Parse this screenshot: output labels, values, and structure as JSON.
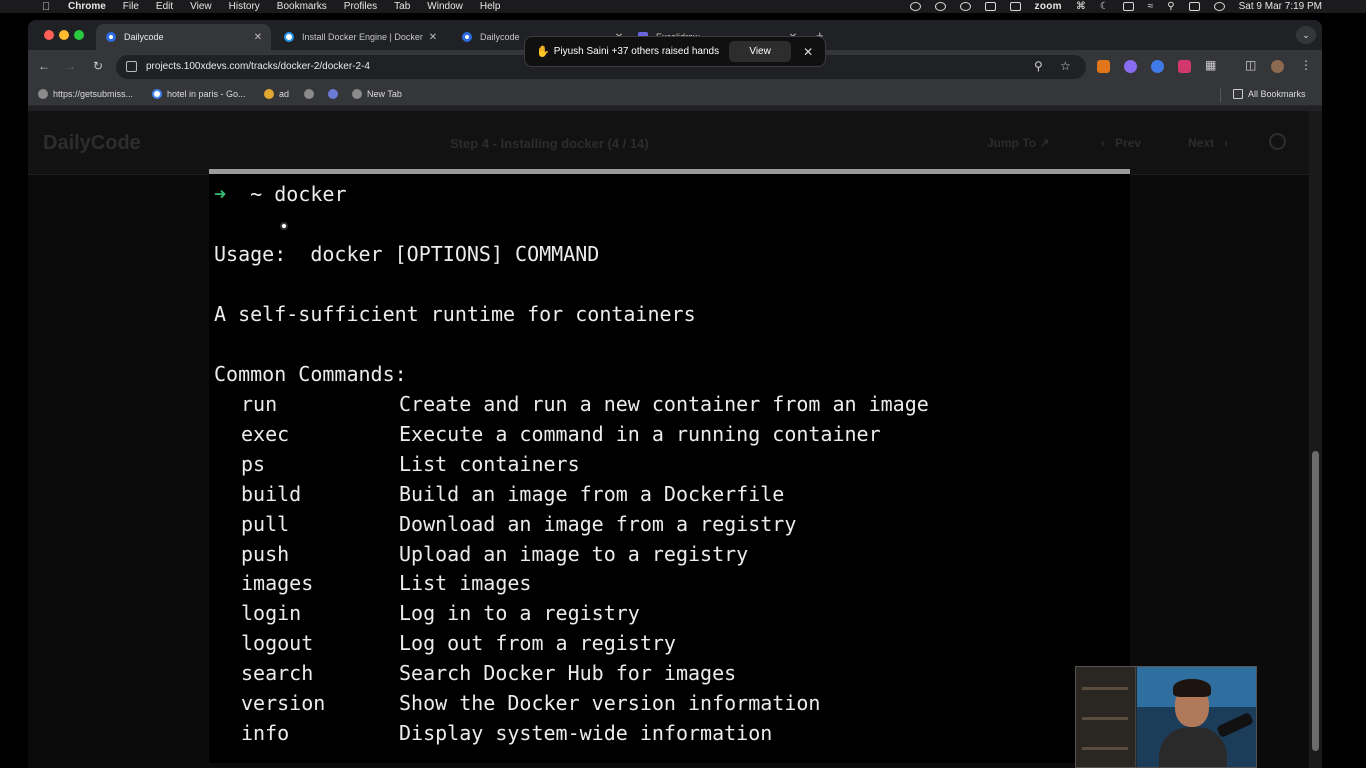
{
  "menubar": {
    "app_name": "Chrome",
    "items": [
      "File",
      "Edit",
      "View",
      "History",
      "Bookmarks",
      "Profiles",
      "Tab",
      "Window",
      "Help"
    ],
    "zoom_label": "zoom",
    "datetime": "Sat 9 Mar  7:19 PM"
  },
  "tabs": [
    {
      "title": "Dailycode",
      "active": true
    },
    {
      "title": "Install Docker Engine | Docker",
      "active": false
    },
    {
      "title": "Dailycode",
      "active": false
    },
    {
      "title": "Excalidraw",
      "active": false
    }
  ],
  "address_bar": {
    "url": "projects.100xdevs.com/tracks/docker-2/docker-2-4"
  },
  "bookmarks": {
    "items": [
      "https://getsubmiss...",
      "hotel in paris - Go...",
      "ad",
      "",
      "",
      "New Tab"
    ],
    "all_bookmarks": "All Bookmarks"
  },
  "zoom_banner": {
    "text": "Piyush Saini +37 others raised hands",
    "view_label": "View"
  },
  "page": {
    "brand": "DailyCode",
    "step_title": "Step 4 - Installing docker (4 / 14)",
    "jump_to": "Jump To",
    "prev": "Prev",
    "next": "Next"
  },
  "terminal": {
    "prompt_arrow": "➜",
    "prompt_dir": "~",
    "command": "docker",
    "usage": "Usage:  docker [OPTIONS] COMMAND",
    "description": "A self-sufficient runtime for containers",
    "section_title": "Common Commands:",
    "commands": [
      {
        "name": "run",
        "desc": "Create and run a new container from an image"
      },
      {
        "name": "exec",
        "desc": "Execute a command in a running container"
      },
      {
        "name": "ps",
        "desc": "List containers"
      },
      {
        "name": "build",
        "desc": "Build an image from a Dockerfile"
      },
      {
        "name": "pull",
        "desc": "Download an image from a registry"
      },
      {
        "name": "push",
        "desc": "Upload an image to a registry"
      },
      {
        "name": "images",
        "desc": "List images"
      },
      {
        "name": "login",
        "desc": "Log in to a registry"
      },
      {
        "name": "logout",
        "desc": "Log out from a registry"
      },
      {
        "name": "search",
        "desc": "Search Docker Hub for images"
      },
      {
        "name": "version",
        "desc": "Show the Docker version information"
      },
      {
        "name": "info",
        "desc": "Display system-wide information"
      }
    ]
  },
  "colors": {
    "prompt_green": "#38c172",
    "terminal_bg": "#000000",
    "terminal_fg": "#ececec"
  }
}
